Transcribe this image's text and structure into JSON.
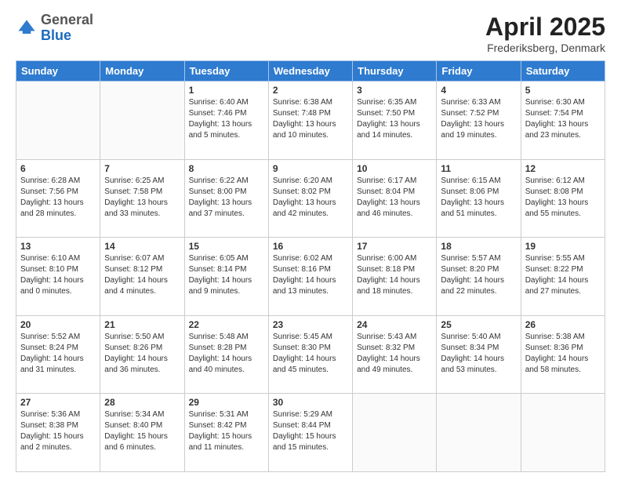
{
  "header": {
    "logo_general": "General",
    "logo_blue": "Blue",
    "title": "April 2025",
    "location": "Frederiksberg, Denmark"
  },
  "days_of_week": [
    "Sunday",
    "Monday",
    "Tuesday",
    "Wednesday",
    "Thursday",
    "Friday",
    "Saturday"
  ],
  "weeks": [
    [
      {
        "day": "",
        "info": ""
      },
      {
        "day": "",
        "info": ""
      },
      {
        "day": "1",
        "info": "Sunrise: 6:40 AM\nSunset: 7:46 PM\nDaylight: 13 hours and 5 minutes."
      },
      {
        "day": "2",
        "info": "Sunrise: 6:38 AM\nSunset: 7:48 PM\nDaylight: 13 hours and 10 minutes."
      },
      {
        "day": "3",
        "info": "Sunrise: 6:35 AM\nSunset: 7:50 PM\nDaylight: 13 hours and 14 minutes."
      },
      {
        "day": "4",
        "info": "Sunrise: 6:33 AM\nSunset: 7:52 PM\nDaylight: 13 hours and 19 minutes."
      },
      {
        "day": "5",
        "info": "Sunrise: 6:30 AM\nSunset: 7:54 PM\nDaylight: 13 hours and 23 minutes."
      }
    ],
    [
      {
        "day": "6",
        "info": "Sunrise: 6:28 AM\nSunset: 7:56 PM\nDaylight: 13 hours and 28 minutes."
      },
      {
        "day": "7",
        "info": "Sunrise: 6:25 AM\nSunset: 7:58 PM\nDaylight: 13 hours and 33 minutes."
      },
      {
        "day": "8",
        "info": "Sunrise: 6:22 AM\nSunset: 8:00 PM\nDaylight: 13 hours and 37 minutes."
      },
      {
        "day": "9",
        "info": "Sunrise: 6:20 AM\nSunset: 8:02 PM\nDaylight: 13 hours and 42 minutes."
      },
      {
        "day": "10",
        "info": "Sunrise: 6:17 AM\nSunset: 8:04 PM\nDaylight: 13 hours and 46 minutes."
      },
      {
        "day": "11",
        "info": "Sunrise: 6:15 AM\nSunset: 8:06 PM\nDaylight: 13 hours and 51 minutes."
      },
      {
        "day": "12",
        "info": "Sunrise: 6:12 AM\nSunset: 8:08 PM\nDaylight: 13 hours and 55 minutes."
      }
    ],
    [
      {
        "day": "13",
        "info": "Sunrise: 6:10 AM\nSunset: 8:10 PM\nDaylight: 14 hours and 0 minutes."
      },
      {
        "day": "14",
        "info": "Sunrise: 6:07 AM\nSunset: 8:12 PM\nDaylight: 14 hours and 4 minutes."
      },
      {
        "day": "15",
        "info": "Sunrise: 6:05 AM\nSunset: 8:14 PM\nDaylight: 14 hours and 9 minutes."
      },
      {
        "day": "16",
        "info": "Sunrise: 6:02 AM\nSunset: 8:16 PM\nDaylight: 14 hours and 13 minutes."
      },
      {
        "day": "17",
        "info": "Sunrise: 6:00 AM\nSunset: 8:18 PM\nDaylight: 14 hours and 18 minutes."
      },
      {
        "day": "18",
        "info": "Sunrise: 5:57 AM\nSunset: 8:20 PM\nDaylight: 14 hours and 22 minutes."
      },
      {
        "day": "19",
        "info": "Sunrise: 5:55 AM\nSunset: 8:22 PM\nDaylight: 14 hours and 27 minutes."
      }
    ],
    [
      {
        "day": "20",
        "info": "Sunrise: 5:52 AM\nSunset: 8:24 PM\nDaylight: 14 hours and 31 minutes."
      },
      {
        "day": "21",
        "info": "Sunrise: 5:50 AM\nSunset: 8:26 PM\nDaylight: 14 hours and 36 minutes."
      },
      {
        "day": "22",
        "info": "Sunrise: 5:48 AM\nSunset: 8:28 PM\nDaylight: 14 hours and 40 minutes."
      },
      {
        "day": "23",
        "info": "Sunrise: 5:45 AM\nSunset: 8:30 PM\nDaylight: 14 hours and 45 minutes."
      },
      {
        "day": "24",
        "info": "Sunrise: 5:43 AM\nSunset: 8:32 PM\nDaylight: 14 hours and 49 minutes."
      },
      {
        "day": "25",
        "info": "Sunrise: 5:40 AM\nSunset: 8:34 PM\nDaylight: 14 hours and 53 minutes."
      },
      {
        "day": "26",
        "info": "Sunrise: 5:38 AM\nSunset: 8:36 PM\nDaylight: 14 hours and 58 minutes."
      }
    ],
    [
      {
        "day": "27",
        "info": "Sunrise: 5:36 AM\nSunset: 8:38 PM\nDaylight: 15 hours and 2 minutes."
      },
      {
        "day": "28",
        "info": "Sunrise: 5:34 AM\nSunset: 8:40 PM\nDaylight: 15 hours and 6 minutes."
      },
      {
        "day": "29",
        "info": "Sunrise: 5:31 AM\nSunset: 8:42 PM\nDaylight: 15 hours and 11 minutes."
      },
      {
        "day": "30",
        "info": "Sunrise: 5:29 AM\nSunset: 8:44 PM\nDaylight: 15 hours and 15 minutes."
      },
      {
        "day": "",
        "info": ""
      },
      {
        "day": "",
        "info": ""
      },
      {
        "day": "",
        "info": ""
      }
    ]
  ]
}
